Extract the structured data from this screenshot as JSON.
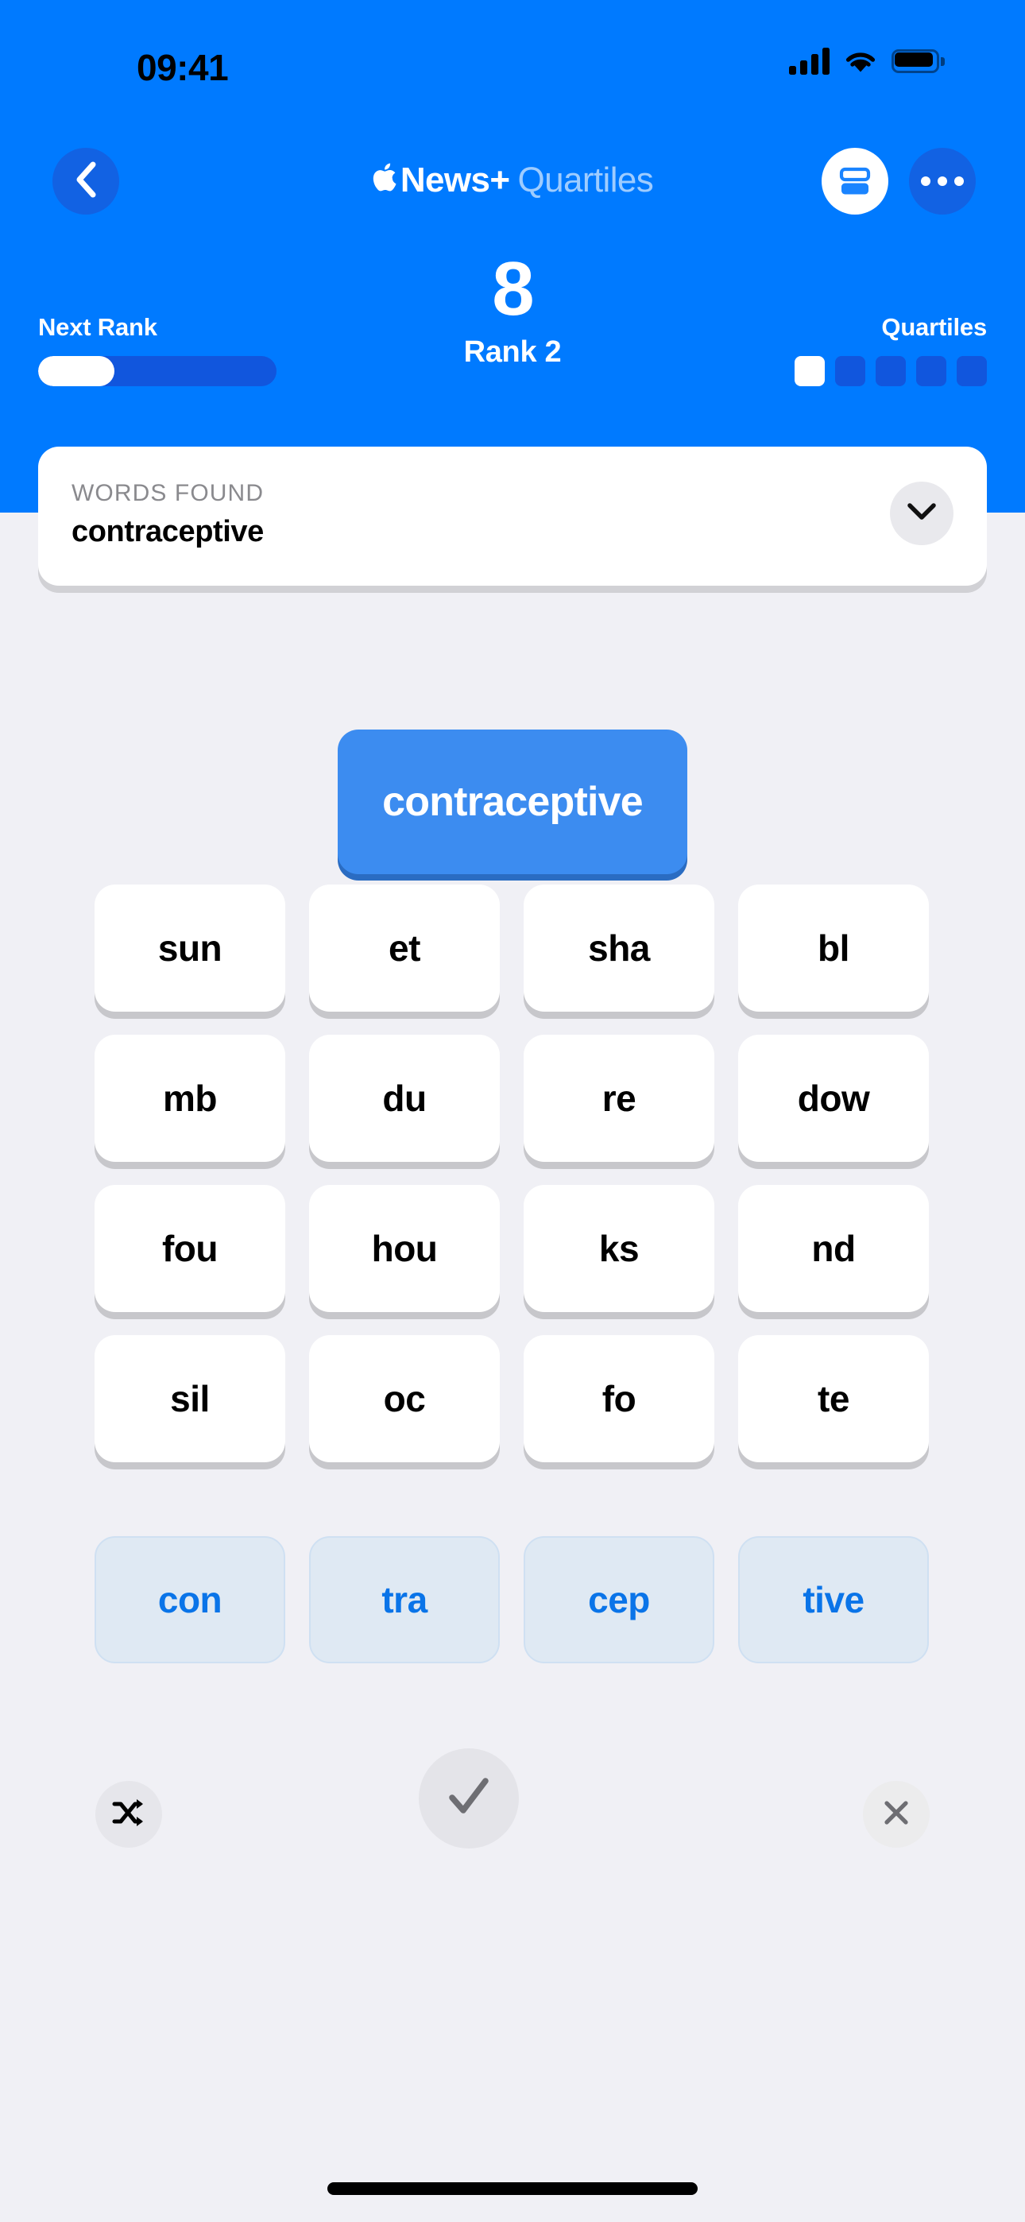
{
  "status_bar": {
    "time": "09:41",
    "signal_icon": "cellular-signal-icon",
    "wifi_icon": "wifi-icon",
    "battery_icon": "battery-icon"
  },
  "nav": {
    "back_icon": "chevron-left-icon",
    "title_brand": "News+",
    "title_suffix": "Quartiles",
    "apple_glyph": "",
    "cards_icon": "cards-layout-icon",
    "more_icon": "more-ellipsis-icon"
  },
  "score": {
    "points": "8",
    "rank_label": "Rank 2"
  },
  "next_rank": {
    "label": "Next Rank",
    "progress_percent": 32
  },
  "quartiles": {
    "label": "Quartiles",
    "total": 5,
    "completed": 1
  },
  "words_found": {
    "label": "WORDS FOUND",
    "value": "contraceptive",
    "expand_icon": "chevron-down-icon"
  },
  "current_word": {
    "text": "contraceptive"
  },
  "tile_grid": {
    "rows": [
      [
        "sun",
        "et",
        "sha",
        "bl"
      ],
      [
        "mb",
        "du",
        "re",
        "dow"
      ],
      [
        "fou",
        "hou",
        "ks",
        "nd"
      ],
      [
        "sil",
        "oc",
        "fo",
        "te"
      ]
    ]
  },
  "selected_tiles": {
    "items": [
      "con",
      "tra",
      "cep",
      "tive"
    ]
  },
  "actions": {
    "shuffle_icon": "shuffle-icon",
    "submit_icon": "checkmark-icon",
    "clear_icon": "close-x-icon"
  },
  "colors": {
    "header_blue": "#007aff",
    "accent_dark_blue": "#1156dd",
    "tile_blue": "#3c8cf0",
    "selected_tile_text": "#0a74e8",
    "page_background": "#f0f0f5"
  }
}
